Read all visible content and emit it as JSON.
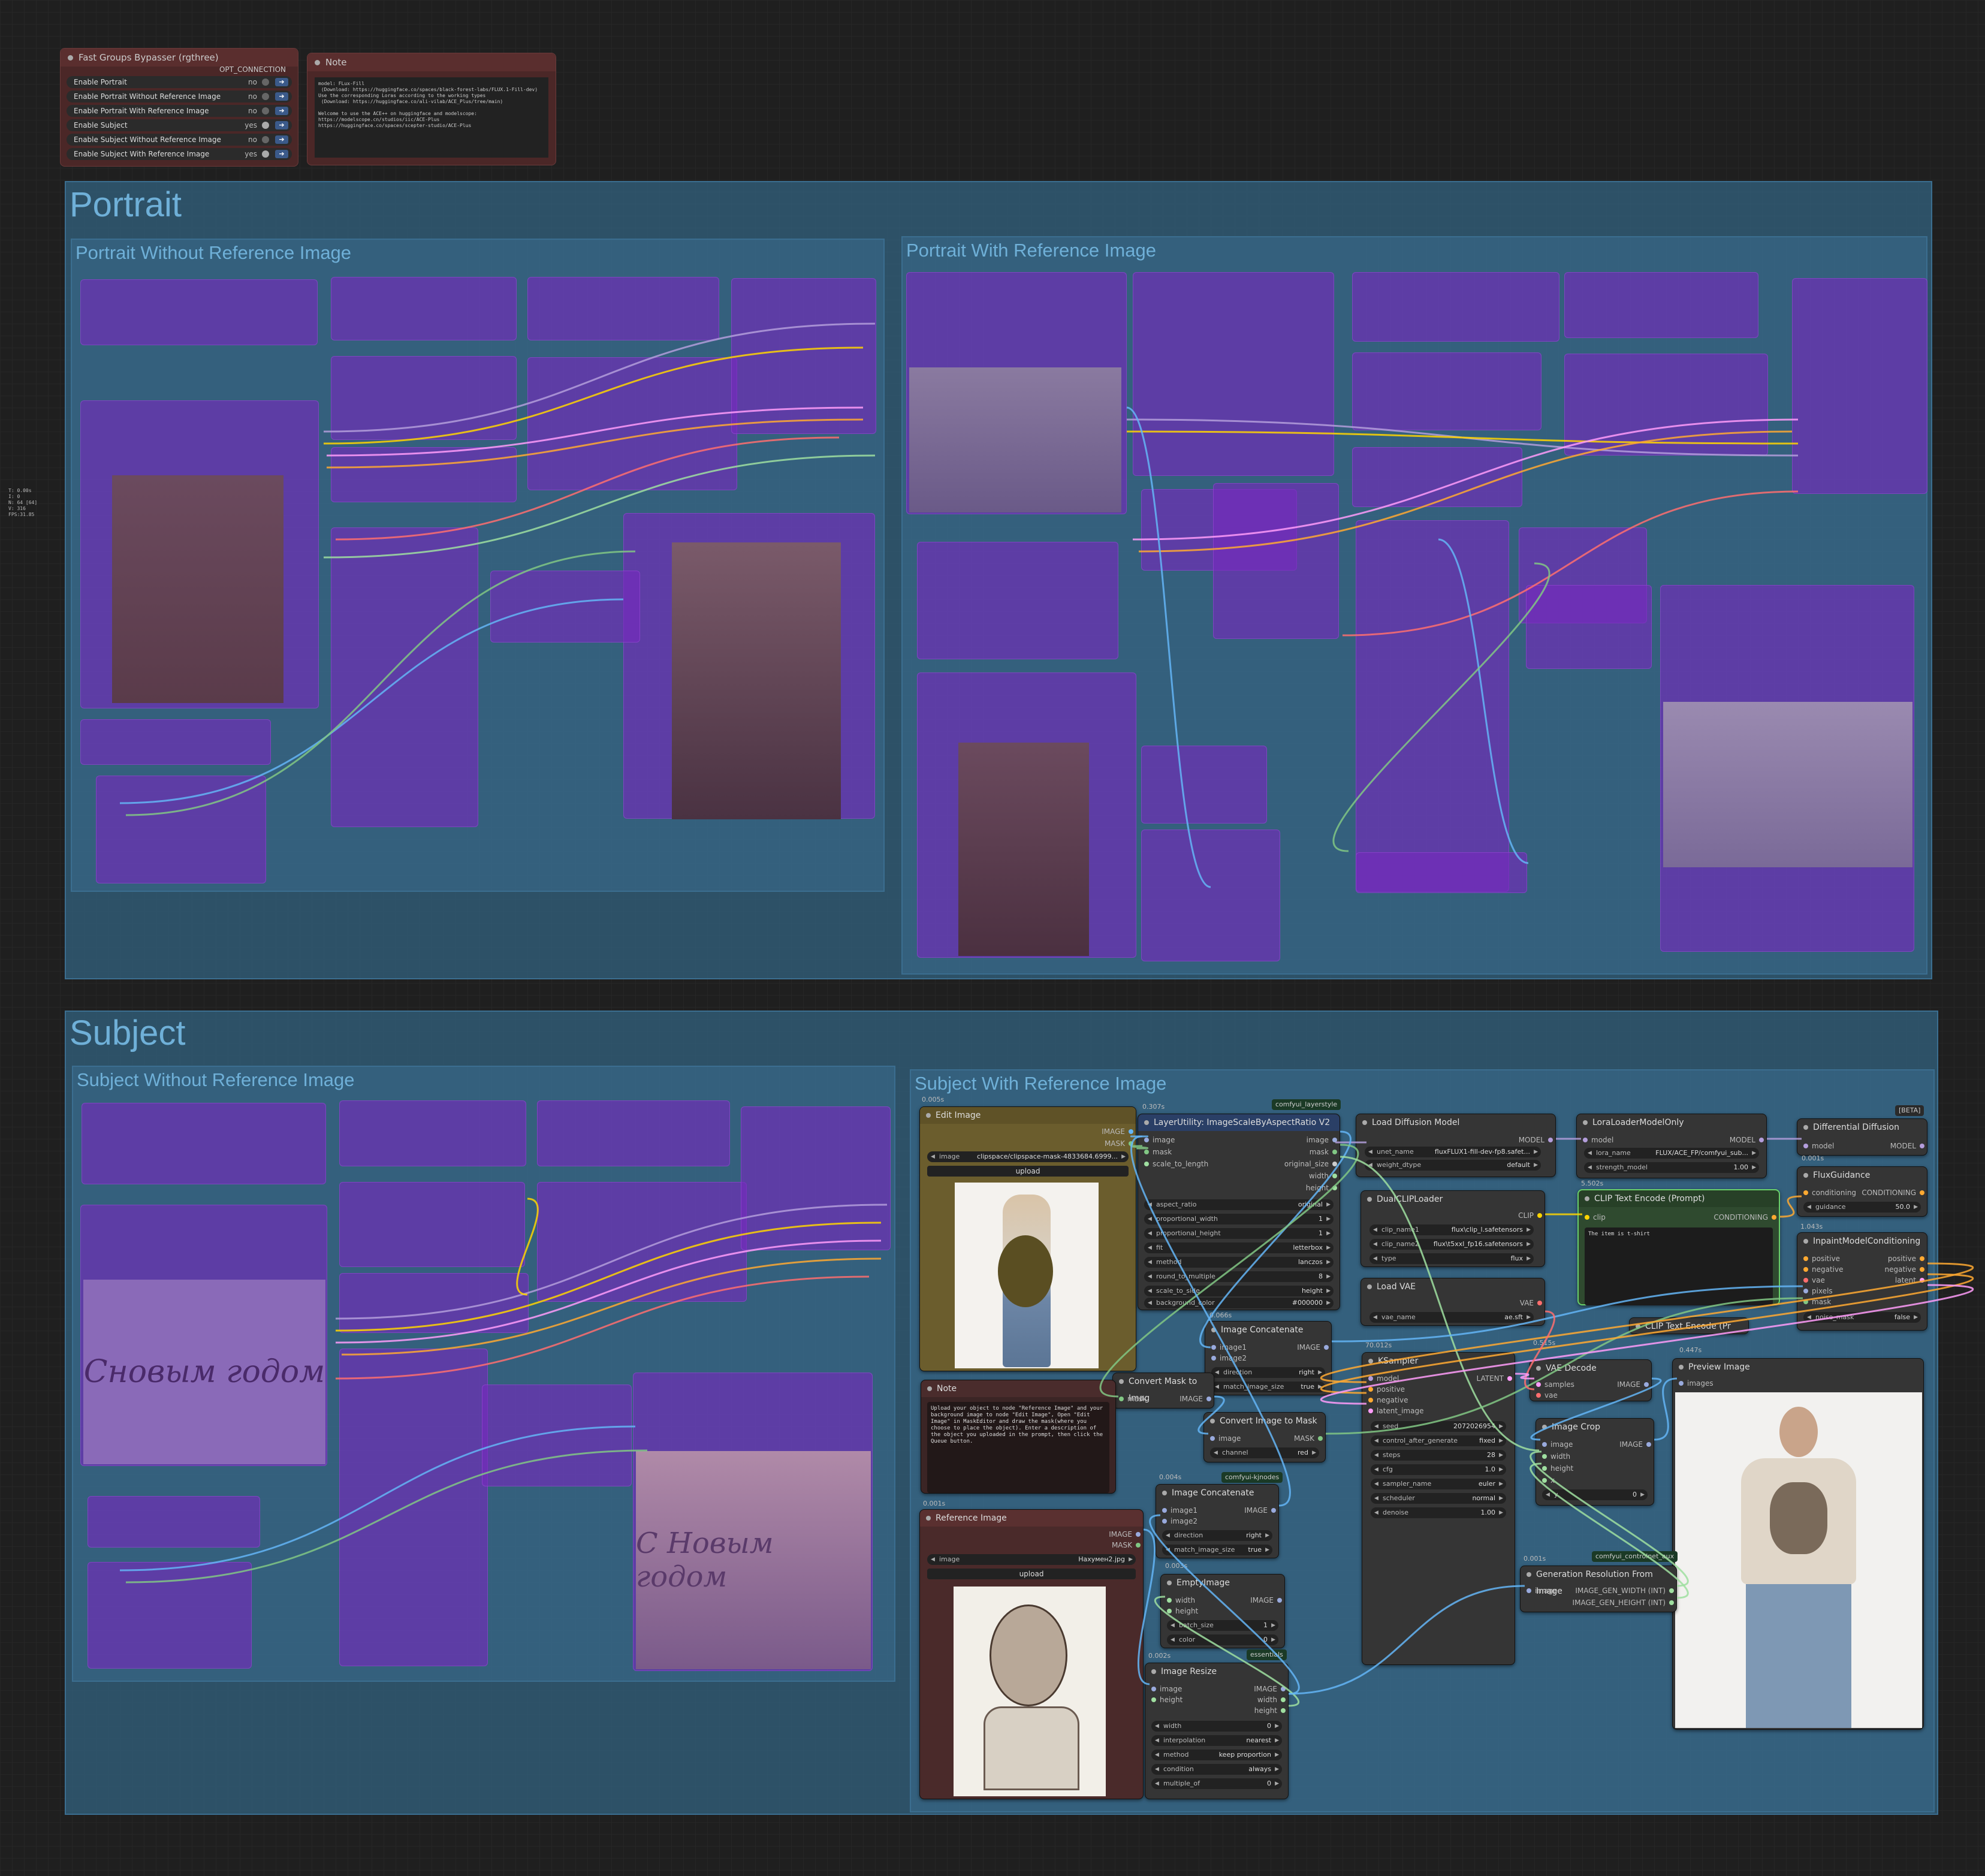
{
  "stats": {
    "lines": [
      "T: 0.00s",
      "I: 0",
      "N: 64 [64]",
      "V: 316",
      "FPS:31.85"
    ]
  },
  "bypasser": {
    "title": "Fast Groups Bypasser (rgthree)",
    "output": "OPT_CONNECTION",
    "rows": [
      {
        "label": "Enable Portrait",
        "value": "no",
        "on": false
      },
      {
        "label": "Enable Portrait Without Reference Image",
        "value": "no",
        "on": false
      },
      {
        "label": "Enable Portrait With Reference Image",
        "value": "no",
        "on": false
      },
      {
        "label": "Enable Subject",
        "value": "yes",
        "on": true
      },
      {
        "label": "Enable Subject Without Reference Image",
        "value": "no",
        "on": false
      },
      {
        "label": "Enable Subject With Reference Image",
        "value": "yes",
        "on": true
      }
    ]
  },
  "top_note": {
    "title": "Note",
    "text": "model: FLux-Fill\n (Download: https://huggingface.co/spaces/black-forest-labs/FLUX.1-Fill-dev)\nUse the corresponding Loras according to the working types\n (Download: https://huggingface.co/ali-vilab/ACE_Plus/tree/main)\n\nWelcome to use the ACE++ on huggingface and modelscope:\nhttps://modelscope.cn/studios/iic/ACE-Plus\nhttps://huggingface.co/spaces/scepter-studio/ACE-Plus"
  },
  "groups": {
    "portrait": "Portrait",
    "portrait_without": "Portrait Without Reference Image",
    "portrait_with": "Portrait With Reference Image",
    "subject": "Subject",
    "subject_without": "Subject Without Reference Image",
    "subject_with": "Subject With Reference Image"
  },
  "nodes": {
    "edit_image": {
      "title": "Edit Image",
      "time": "0.005s",
      "outputs": [
        "IMAGE",
        "MASK"
      ],
      "image_label": "image",
      "image_value": "clipspace/clipspace-mask-4833684.6999...",
      "upload": "upload"
    },
    "layer_utility": {
      "title": "LayerUtility: ImageScaleByAspectRatio V2",
      "time": "0.307s",
      "badge": "comfyui_layerstyle",
      "inputs": [
        "image",
        "mask",
        "scale_to_length"
      ],
      "outputs": [
        "image",
        "mask",
        "original_size",
        "width",
        "height"
      ],
      "widgets": [
        {
          "label": "aspect_ratio",
          "value": "original"
        },
        {
          "label": "proportional_width",
          "value": "1"
        },
        {
          "label": "proportional_height",
          "value": "1"
        },
        {
          "label": "fit",
          "value": "letterbox"
        },
        {
          "label": "method",
          "value": "lanczos"
        },
        {
          "label": "round_to_multiple",
          "value": "8"
        },
        {
          "label": "scale_to_side",
          "value": "height"
        },
        {
          "label": "background_color",
          "value": "#000000"
        }
      ]
    },
    "load_diffusion": {
      "title": "Load Diffusion Model",
      "output": "MODEL",
      "widgets": [
        {
          "label": "unet_name",
          "value": "fluxFLUX1-fill-dev-fp8.safet..."
        },
        {
          "label": "weight_dtype",
          "value": "default"
        }
      ]
    },
    "lora_loader": {
      "title": "LoraLoaderModelOnly",
      "time": "0.001s",
      "input": "model",
      "output": "MODEL",
      "widgets": [
        {
          "label": "lora_name",
          "value": "FLUX/ACE_FP/comfyui_sub..."
        },
        {
          "label": "strength_model",
          "value": "1.00"
        }
      ]
    },
    "diff_diffusion": {
      "title": "Differential Diffusion",
      "badge": "[BETA]",
      "input": "model",
      "output": "MODEL"
    },
    "dual_clip": {
      "title": "DualCLIPLoader",
      "output": "CLIP",
      "widgets": [
        {
          "label": "clip_name1",
          "value": "flux\\clip_l.safetensors"
        },
        {
          "label": "clip_name2",
          "value": "flux\\t5xxl_fp16.safetensors"
        },
        {
          "label": "type",
          "value": "flux"
        }
      ]
    },
    "clip_text": {
      "title": "CLIP Text Encode (Prompt)",
      "time": "5.502s",
      "input": "clip",
      "output": "CONDITIONING",
      "text": "The item is t-shirt"
    },
    "flux_guidance": {
      "title": "FluxGuidance",
      "time": "1.043s",
      "input": "conditioning",
      "output": "CONDITIONING",
      "widgets": [
        {
          "label": "guidance",
          "value": "50.0"
        }
      ]
    },
    "inpaint_cond": {
      "title": "InpaintModelConditioning",
      "inputs": [
        "positive",
        "negative",
        "vae",
        "pixels",
        "mask"
      ],
      "outputs": [
        "positive",
        "negative",
        "latent"
      ],
      "widgets": [
        {
          "label": "noise_mask",
          "value": "false"
        }
      ]
    },
    "load_vae": {
      "title": "Load VAE",
      "output": "VAE",
      "widgets": [
        {
          "label": "vae_name",
          "value": "ae.sft"
        }
      ]
    },
    "clip_text_collapsed": {
      "title": "CLIP Text Encode (Pr"
    },
    "image_concat1": {
      "title": "Image Concatenate",
      "time": "0.066s",
      "inputs": [
        "image1",
        "image2"
      ],
      "output": "IMAGE",
      "widgets": [
        {
          "label": "direction",
          "value": "right"
        },
        {
          "label": "match_image_size",
          "value": "true"
        }
      ]
    },
    "convert_mask": {
      "title": "Convert Mask to Imag",
      "input": "mask",
      "output": "IMAGE"
    },
    "convert_image": {
      "title": "Convert Image to Mask",
      "input": "image",
      "output": "MASK",
      "widgets": [
        {
          "label": "channel",
          "value": "red"
        }
      ]
    },
    "ksampler": {
      "title": "KSampler",
      "time": "70.012s",
      "inputs": [
        "model",
        "positive",
        "negative",
        "latent_image"
      ],
      "output": "LATENT",
      "widgets": [
        {
          "label": "seed",
          "value": "2072026954"
        },
        {
          "label": "control_after_generate",
          "value": "fixed"
        },
        {
          "label": "steps",
          "value": "28"
        },
        {
          "label": "cfg",
          "value": "1.0"
        },
        {
          "label": "sampler_name",
          "value": "euler"
        },
        {
          "label": "scheduler",
          "value": "normal"
        },
        {
          "label": "denoise",
          "value": "1.00"
        }
      ]
    },
    "vae_decode": {
      "title": "VAE Decode",
      "time": "0.515s",
      "inputs": [
        "samples",
        "vae"
      ],
      "output": "IMAGE"
    },
    "preview": {
      "title": "Preview Image",
      "time": "0.447s",
      "input": "images"
    },
    "image_crop": {
      "title": "Image Crop",
      "inputs": [
        "image",
        "width",
        "height",
        "x"
      ],
      "output": "IMAGE",
      "widgets": [
        {
          "label": "y",
          "value": "0"
        }
      ]
    },
    "note_subject": {
      "title": "Note",
      "text": "Upload your object to node \"Reference Image\" and your background image to node \"Edit Image\", Open \"Edit Image\" in MaskEditor and draw the mask(where you choose to place the object). Enter a description of the object you uploaded in the prompt, then click the Queue button."
    },
    "image_concat2": {
      "title": "Image Concatenate",
      "time": "0.004s",
      "badge": "comfyui-kjnodes",
      "inputs": [
        "image1",
        "image2"
      ],
      "output": "IMAGE",
      "widgets": [
        {
          "label": "direction",
          "value": "right"
        },
        {
          "label": "match_image_size",
          "value": "true"
        }
      ]
    },
    "empty_image": {
      "title": "EmptyImage",
      "time": "0.003s",
      "inputs": [
        "width",
        "height"
      ],
      "output": "IMAGE",
      "widgets": [
        {
          "label": "batch_size",
          "value": "1"
        },
        {
          "label": "color",
          "value": "0"
        }
      ]
    },
    "image_resize": {
      "title": "Image Resize",
      "time": "0.002s",
      "badge": "essentials",
      "inputs": [
        "image",
        "height"
      ],
      "outputs": [
        "IMAGE",
        "width",
        "height"
      ],
      "widgets": [
        {
          "label": "width",
          "value": "0"
        },
        {
          "label": "interpolation",
          "value": "nearest"
        },
        {
          "label": "method",
          "value": "keep proportion"
        },
        {
          "label": "condition",
          "value": "always"
        },
        {
          "label": "multiple_of",
          "value": "0"
        }
      ]
    },
    "reference_image": {
      "title": "Reference Image",
      "time": "0.001s",
      "outputs": [
        "IMAGE",
        "MASK"
      ],
      "image_label": "image",
      "image_value": "Нахумен2.jpg",
      "upload": "upload"
    },
    "gen_resolution": {
      "title": "Generation Resolution From Image",
      "time": "0.001s",
      "badge": "comfyui_controlnet_aux",
      "input": "image",
      "outputs": [
        "IMAGE_GEN_WIDTH (INT)",
        "IMAGE_GEN_HEIGHT (INT)"
      ]
    }
  },
  "bypassed_text": {
    "portrait_card": "Сновым годом",
    "subject_card": "С Новым годом"
  },
  "wire_colors": {
    "model": "#b39ddb",
    "clip": "#ffd500",
    "conditioning": "#ffa931",
    "vae": "#ff6e6e",
    "image": "#64b5f6",
    "mask": "#81c784",
    "latent": "#ff9cf9",
    "int": "#9fdfa0"
  }
}
